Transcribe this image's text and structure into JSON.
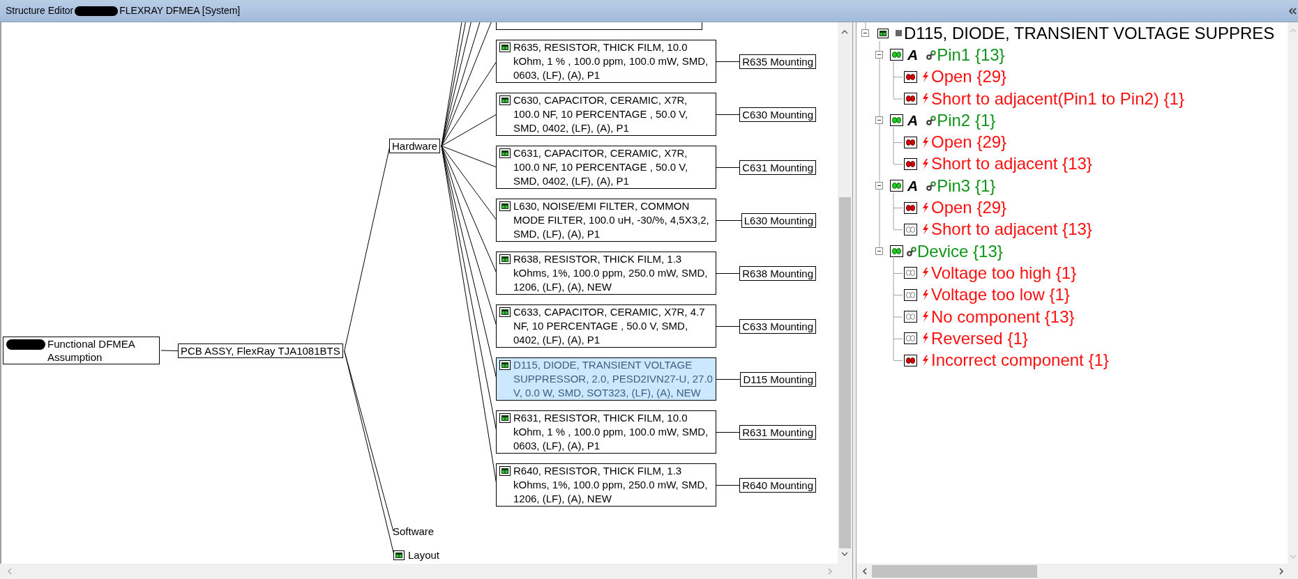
{
  "window": {
    "title_parts": [
      "Structure Editor",
      "FLEXRAY DFMEA [System]"
    ]
  },
  "structure": {
    "root_label": "Functional DFMEA Assumption",
    "assembly": "PCB ASSY, FlexRay TJA1081BTS",
    "branches": [
      {
        "kind": "box",
        "label": "Hardware",
        "parts": [
          {
            "kind": "clipped",
            "selected": false
          },
          {
            "kind": "part",
            "label": "R635, RESISTOR, THICK FILM, 10.0 kOhm, 1 % , 100.0 ppm, 100.0 mW, SMD, 0603, (LF), (A), P1",
            "mounting": "R635 Mounting",
            "selected": false
          },
          {
            "kind": "part",
            "label": "C630, CAPACITOR, CERAMIC, X7R, 100.0 NF, 10 PERCENTAGE , 50.0 V, SMD, 0402, (LF), (A), P1",
            "mounting": "C630 Mounting",
            "selected": false
          },
          {
            "kind": "part",
            "label": "C631, CAPACITOR, CERAMIC, X7R, 100.0 NF, 10 PERCENTAGE , 50.0 V, SMD, 0402, (LF), (A), P1",
            "mounting": "C631 Mounting",
            "selected": false
          },
          {
            "kind": "part",
            "label": "L630, NOISE/EMI FILTER, COMMON MODE FILTER, 100.0 uH, -30/%, 4,5X3,2, SMD, (LF), (A), P1",
            "mounting": "L630 Mounting",
            "selected": false
          },
          {
            "kind": "part",
            "label": "R638, RESISTOR, THICK FILM, 1.3 kOhms, 1%, 100.0 ppm, 250.0 mW, SMD, 1206, (LF), (A), NEW",
            "mounting": "R638 Mounting",
            "selected": false
          },
          {
            "kind": "part",
            "label": "C633, CAPACITOR, CERAMIC, X7R, 4.7 NF, 10 PERCENTAGE , 50.0 V, SMD, 0402, (LF), (A), P1",
            "mounting": "C633 Mounting",
            "selected": false
          },
          {
            "kind": "part",
            "label": "D115, DIODE, TRANSIENT VOLTAGE SUPPRESSOR, 2.0, PESD2IVN27-U, 27.0 V, 0.0 W, SMD, SOT323, (LF), (A), NEW",
            "mounting": "D115 Mounting",
            "selected": true
          },
          {
            "kind": "part",
            "label": "R631, RESISTOR, THICK FILM, 10.0 kOhm, 1 % , 100.0 ppm, 100.0 mW, SMD, 0603, (LF), (A), P1",
            "mounting": "R631 Mounting",
            "selected": false
          },
          {
            "kind": "part",
            "label": "R640, RESISTOR, THICK FILM, 1.3 kOhms, 1%, 100.0 ppm, 250.0 mW, SMD, 1206, (LF), (A), NEW",
            "mounting": "R640 Mounting",
            "selected": false
          }
        ]
      },
      {
        "kind": "plain",
        "label": "Software"
      },
      {
        "kind": "icon",
        "label": "Layout"
      }
    ]
  },
  "failure_tree": {
    "label": "D115, DIODE, TRANSIENT VOLTAGE SUPPRES",
    "expanded": true,
    "children": [
      {
        "kind": "pin",
        "badge": "A",
        "label": "Pin1 {13}",
        "expanded": true,
        "children": [
          {
            "kind": "failure",
            "label": "Open {29}",
            "flagged": true
          },
          {
            "kind": "failure",
            "label": "Short to adjacent(Pin1 to Pin2) {1}",
            "flagged": true
          }
        ]
      },
      {
        "kind": "pin",
        "badge": "A",
        "label": "Pin2 {1}",
        "expanded": true,
        "children": [
          {
            "kind": "failure",
            "label": "Open {29}",
            "flagged": true
          },
          {
            "kind": "failure",
            "label": "Short to adjacent {13}",
            "flagged": true
          }
        ]
      },
      {
        "kind": "pin",
        "badge": "A",
        "label": "Pin3 {1}",
        "expanded": true,
        "children": [
          {
            "kind": "failure",
            "label": "Open {29}",
            "flagged": true
          },
          {
            "kind": "failure",
            "label": "Short to adjacent {13}",
            "flagged": false
          }
        ]
      },
      {
        "kind": "device",
        "label": "Device {13}",
        "expanded": true,
        "children": [
          {
            "kind": "failure",
            "label": "Voltage too high {1}",
            "flagged": false
          },
          {
            "kind": "failure",
            "label": "Voltage too low {1}",
            "flagged": false
          },
          {
            "kind": "failure",
            "label": "No component {13}",
            "flagged": false
          },
          {
            "kind": "failure",
            "label": "Reversed {1}",
            "flagged": false
          },
          {
            "kind": "failure",
            "label": "Incorrect component {1}",
            "flagged": true
          }
        ]
      }
    ]
  }
}
